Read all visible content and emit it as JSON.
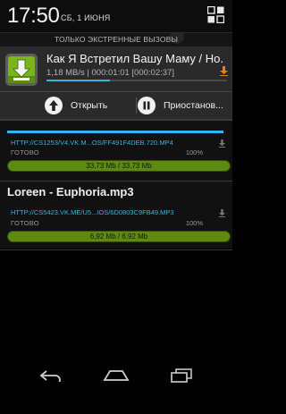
{
  "status": {
    "time": "17:50",
    "date": "СБ, 1 ИЮНЯ"
  },
  "emergency_banner": {
    "label": "ТОЛЬКО ЭКСТРЕННЫЕ ВЫЗОВЫ"
  },
  "notification": {
    "title": "Как Я Встретил Вашу Маму / Но.",
    "status": "1,18 MB/s | 000:01:01 [000:02:37]",
    "progress": 0.35,
    "actions": {
      "open_label": "Открыть",
      "pause_label": "Приостанов..."
    }
  },
  "downloads": [
    {
      "name": "",
      "url": "HTTP://CS1253/V4.VK.M...OS/FF491F4DEB.720.MP4",
      "state": "ГОТОВО",
      "percent": "100%",
      "size": "33,73 Mb / 33,73 Mb",
      "progress": 1.0
    },
    {
      "name": "Loreen - Euphoria.mp3",
      "url": "HTTP://CS5423.VK.ME/U5...IOS/6D0803C9FB49.MP3",
      "state": "ГОТОВО",
      "percent": "100%",
      "size": "6,92 Mb / 6,92 Mb",
      "progress": 1.0
    }
  ],
  "colors": {
    "accent": "#33b5e5",
    "done_bar": "#5f8a12",
    "notification_bg": "#2a2a2a"
  },
  "icons": {
    "quick_settings": "quick-settings-icon",
    "app": "download-manager-app-icon",
    "back": "back-icon",
    "home": "home-icon",
    "recents": "recents-icon"
  }
}
